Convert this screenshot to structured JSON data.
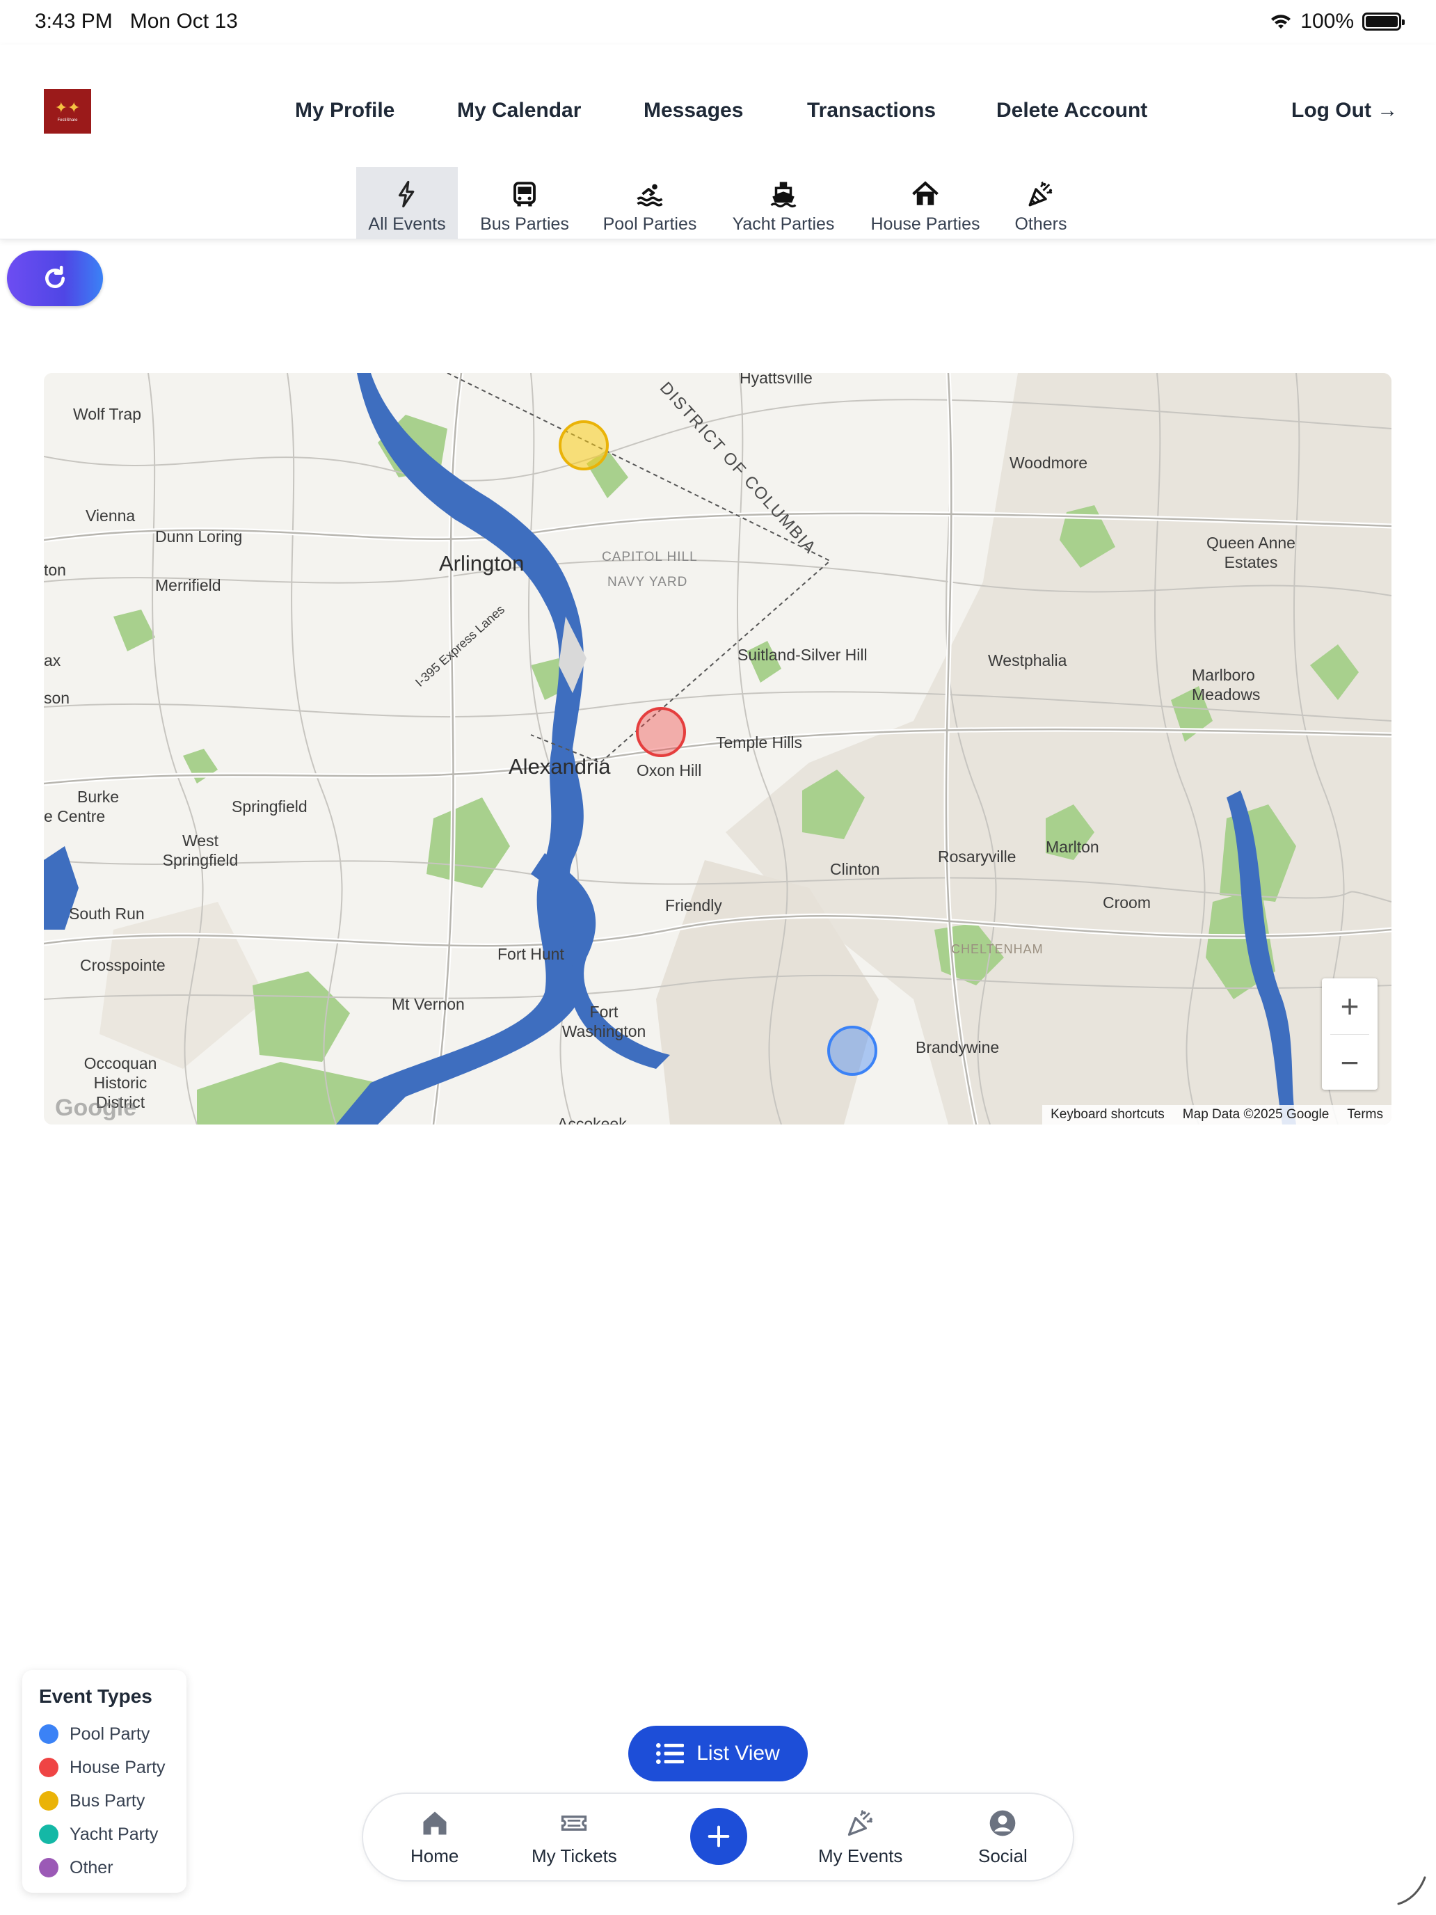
{
  "status_bar": {
    "time": "3:43 PM",
    "date": "Mon Oct 13",
    "battery": "100%"
  },
  "header": {
    "logo_text": "FestiShare",
    "nav": {
      "profile": "My Profile",
      "calendar": "My Calendar",
      "messages": "Messages",
      "transactions": "Transactions",
      "delete": "Delete Account",
      "logout": "Log Out →"
    },
    "tabs": [
      "All Events",
      "Bus Parties",
      "Pool Parties",
      "Yacht Parties",
      "House Parties",
      "Others"
    ]
  },
  "map": {
    "labels": {
      "hyattsville": "Hyattsville",
      "wolf_trap": "Wolf Trap",
      "vienna": "Vienna",
      "dunn_loring": "Dunn Loring",
      "arlington": "Arlington",
      "merrifield": "Merrifield",
      "capitol_hill": "CAPITOL HILL",
      "navy_yard": "NAVY YARD",
      "dc": "DISTRICT OF COLUMBIA",
      "woodmore": "Woodmore",
      "queen_anne": "Queen Anne Estates",
      "suitland": "Suitland-Silver Hill",
      "westphalia": "Westphalia",
      "marlboro": "Marlboro Meadows",
      "temple_hills": "Temple Hills",
      "oxon_hill": "Oxon Hill",
      "alexandria": "Alexandria",
      "burke": "Burke",
      "centre": "e Centre",
      "springfield": "Springfield",
      "west_springfield": "West Springfield",
      "clinton": "Clinton",
      "rosaryville": "Rosaryville",
      "marlton": "Marlton",
      "friendly": "Friendly",
      "croom": "Croom",
      "south_run": "South Run",
      "fort_hunt": "Fort Hunt",
      "cheltenham": "CHELTENHAM",
      "crosspointe": "Crosspointe",
      "mt_vernon": "Mt Vernon",
      "fort_washington": "Fort Washington",
      "brandywine": "Brandywine",
      "occoquan": "Occoquan Historic District",
      "accokeek": "Accokeek",
      "express": "I-395 Express Lanes",
      "lorton": "ton",
      "fairfax": "ax",
      "jefferson": "son"
    },
    "footer": {
      "shortcuts": "Keyboard shortcuts",
      "data": "Map Data ©2025 Google",
      "terms": "Terms"
    },
    "google": "Google",
    "zoom_in": "+",
    "zoom_out": "−"
  },
  "legend": {
    "title": "Event Types",
    "items": [
      {
        "label": "Pool Party",
        "color": "#3b82f6"
      },
      {
        "label": "House Party",
        "color": "#ef4444"
      },
      {
        "label": "Bus Party",
        "color": "#eab308"
      },
      {
        "label": "Yacht Party",
        "color": "#14b8a6"
      },
      {
        "label": "Other",
        "color": "#9b59b6"
      }
    ]
  },
  "list_view": "List View",
  "bottom_nav": {
    "home": "Home",
    "tickets": "My Tickets",
    "events": "My Events",
    "social": "Social"
  }
}
